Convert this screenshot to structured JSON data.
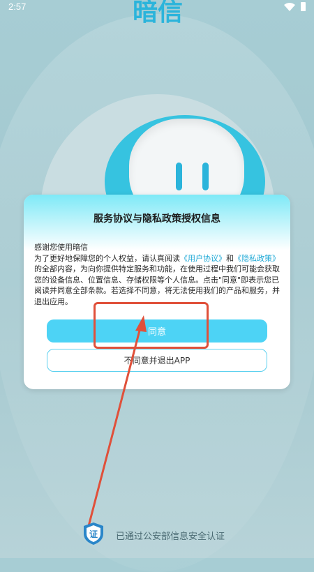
{
  "status_bar": {
    "time": "2:57"
  },
  "background": {
    "app_title": "暗信"
  },
  "dialog": {
    "title": "服务协议与隐私政策授权信息",
    "greeting": "感谢您使用暗信",
    "body_part1": "为了更好地保障您的个人权益，请认真阅读",
    "user_agreement_link": "《用户协议》",
    "and_text": "和",
    "privacy_policy_link": "《隐私政策》",
    "body_part2": "的全部内容，为向你提供特定服务和功能，在使用过程中我们可能会获取您的设备信息、位置信息、存储权限等个人信息。点击\"同意\"即表示您已阅读并同意全部条款。若选择不同意，将无法使用我们的产品和服务，并退出应用。",
    "agree_label": "同意",
    "disagree_label": "不同意并退出APP"
  },
  "footer": {
    "cert_badge_text": "证",
    "cert_text": "已通过公安部信息安全认证"
  },
  "colors": {
    "accent": "#4dd3f5",
    "link": "#20a9d6",
    "annotation": "#e0503a"
  }
}
